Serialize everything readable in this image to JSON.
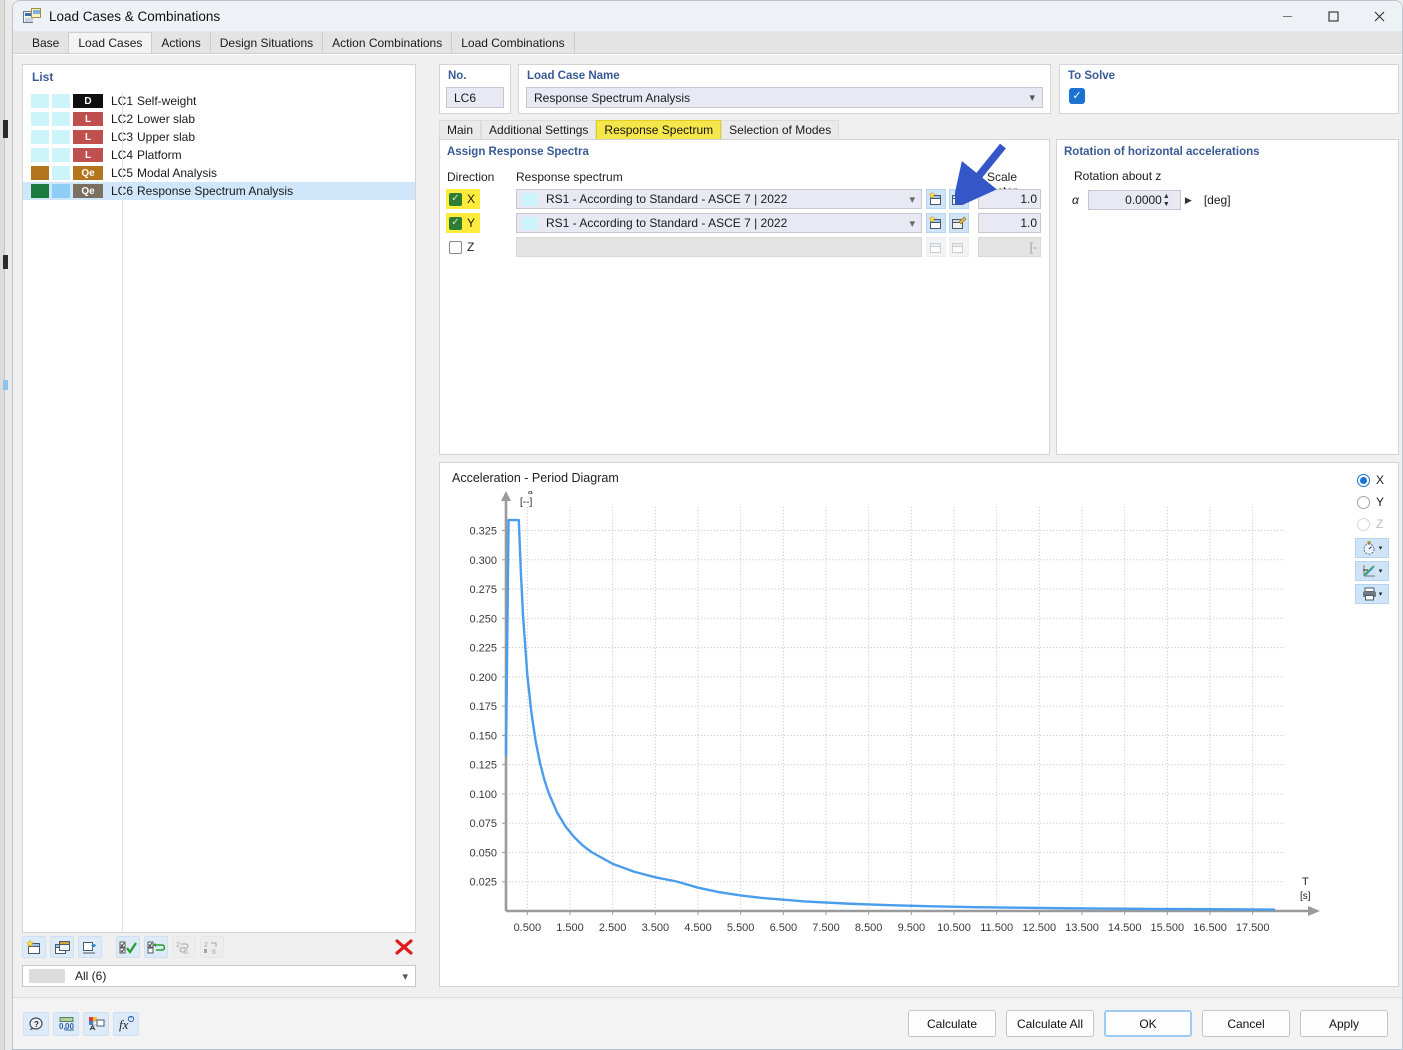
{
  "window": {
    "title": "Load Cases & Combinations",
    "icon": "load-cases-icon",
    "minimize": "—",
    "maximize": "☐",
    "close": "✕"
  },
  "main_tabs": [
    {
      "label": "Base",
      "active": false
    },
    {
      "label": "Load Cases",
      "active": true
    },
    {
      "label": "Actions",
      "active": false
    },
    {
      "label": "Design Situations",
      "active": false
    },
    {
      "label": "Action Combinations",
      "active": false
    },
    {
      "label": "Load Combinations",
      "active": false
    }
  ],
  "list_panel": {
    "header": "List",
    "rows": [
      {
        "no": "LC1",
        "name": "Self-weight",
        "category": "D",
        "cat_color": "#0f0f0f",
        "sw1": "#cdf3fb",
        "sw2": "#cdf3fb",
        "selected": false
      },
      {
        "no": "LC2",
        "name": "Lower slab",
        "category": "L",
        "cat_color": "#c0504d",
        "sw1": "#cdf3fb",
        "sw2": "#cdf3fb",
        "selected": false
      },
      {
        "no": "LC3",
        "name": "Upper slab",
        "category": "L",
        "cat_color": "#c0504d",
        "sw1": "#cdf3fb",
        "sw2": "#cdf3fb",
        "selected": false
      },
      {
        "no": "LC4",
        "name": "Platform",
        "category": "L",
        "cat_color": "#c0504d",
        "sw1": "#cdf3fb",
        "sw2": "#cdf3fb",
        "selected": false
      },
      {
        "no": "LC5",
        "name": "Modal Analysis",
        "category": "Qe",
        "cat_color": "#b3761f",
        "sw1": "#b3761f",
        "sw2": "#cdf3fb",
        "selected": false
      },
      {
        "no": "LC6",
        "name": "Response Spectrum Analysis",
        "category": "Qe",
        "cat_color": "#7a6f60",
        "sw1": "#1b7a3d",
        "sw2": "#8ecdf5",
        "selected": true
      }
    ],
    "toolbar": [
      {
        "name": "new-load-case-button",
        "enabled": true
      },
      {
        "name": "copy-load-case-button",
        "enabled": true
      },
      {
        "name": "import-load-case-button",
        "enabled": true
      },
      {
        "name": "select-all-button",
        "enabled": true
      },
      {
        "name": "invert-selection-button",
        "enabled": true
      },
      {
        "name": "renumber-button",
        "enabled": false
      },
      {
        "name": "sort-button",
        "enabled": false
      },
      {
        "name": "delete-load-case-button",
        "enabled": true
      }
    ],
    "filter": "All (6)"
  },
  "header": {
    "no_label": "No.",
    "no_value": "LC6",
    "name_label": "Load Case Name",
    "name_value": "Response Spectrum Analysis",
    "to_solve_label": "To Solve",
    "to_solve_checked": true,
    "check_glyph": "✓"
  },
  "inner_tabs": [
    {
      "label": "Main",
      "active": false
    },
    {
      "label": "Additional Settings",
      "active": false
    },
    {
      "label": "Response Spectrum",
      "active": true
    },
    {
      "label": "Selection of Modes",
      "active": false
    }
  ],
  "assign": {
    "title": "Assign Response Spectra",
    "col_direction": "Direction",
    "col_spectrum": "Response spectrum",
    "col_scale": "Scale factor",
    "rows": [
      {
        "direction": "X",
        "checked": true,
        "highlight": true,
        "spectrum": "RS1 - According to Standard - ASCE 7 | 2022",
        "scale": "1.0",
        "enabled": true
      },
      {
        "direction": "Y",
        "checked": true,
        "highlight": true,
        "spectrum": "RS1 - According to Standard - ASCE 7 | 2022",
        "scale": "1.0",
        "enabled": true
      },
      {
        "direction": "Z",
        "checked": false,
        "highlight": false,
        "spectrum": "",
        "scale": "[-",
        "enabled": false
      }
    ]
  },
  "rotation": {
    "title": "Rotation of horizontal accelerations",
    "sub_label": "Rotation about z",
    "alpha_symbol": "α",
    "alpha_value": "0.0000",
    "unit": "[deg]"
  },
  "chart_panel": {
    "title": "Acceleration - Period Diagram",
    "directions": [
      {
        "label": "X",
        "selected": true,
        "enabled": true
      },
      {
        "label": "Y",
        "selected": false,
        "enabled": true
      },
      {
        "label": "Z",
        "selected": false,
        "enabled": false
      }
    ],
    "tool_buttons": [
      {
        "name": "diagram-settings-button",
        "caret": "▾"
      },
      {
        "name": "diagram-style-button",
        "caret": "▾"
      },
      {
        "name": "print-diagram-button",
        "caret": "▾"
      }
    ]
  },
  "chart_data": {
    "type": "line",
    "title": "Acceleration - Period Diagram",
    "xlabel": "T",
    "xunit": "[s]",
    "ylabel": "Sa",
    "yunit": "[--]",
    "grid": true,
    "legend": false,
    "xlim": [
      0.0,
      18.0
    ],
    "ylim": [
      0.0,
      0.34
    ],
    "xticks": [
      0.5,
      1.5,
      2.5,
      3.5,
      4.5,
      5.5,
      6.5,
      7.5,
      8.5,
      9.5,
      10.5,
      11.5,
      12.5,
      13.5,
      14.5,
      15.5,
      16.5,
      17.5
    ],
    "yticks": [
      0.025,
      0.05,
      0.075,
      0.1,
      0.125,
      0.15,
      0.175,
      0.2,
      0.225,
      0.25,
      0.275,
      0.3,
      0.325
    ],
    "series": [
      {
        "name": "RS1 - According to Standard - ASCE 7 | 2022",
        "color": "#4a9ded",
        "x": [
          0.0,
          0.06,
          0.3,
          0.35,
          0.4,
          0.5,
          0.6,
          0.7,
          0.8,
          0.9,
          1.0,
          1.2,
          1.4,
          1.6,
          1.8,
          2.0,
          2.5,
          3.0,
          3.5,
          4.0,
          4.5,
          5.0,
          5.5,
          6.0,
          7.0,
          8.0,
          9.0,
          10.0,
          11.0,
          12.0,
          13.0,
          14.0,
          15.0,
          16.0,
          17.0,
          18.0
        ],
        "y": [
          0.1337,
          0.334,
          0.334,
          0.288,
          0.252,
          0.2016,
          0.168,
          0.144,
          0.126,
          0.112,
          0.1008,
          0.084,
          0.072,
          0.063,
          0.056,
          0.0504,
          0.0403,
          0.0336,
          0.0288,
          0.0252,
          0.0199,
          0.0161,
          0.0133,
          0.0112,
          0.0082,
          0.0063,
          0.005,
          0.004,
          0.0033,
          0.0028,
          0.0024,
          0.0021,
          0.0018,
          0.0016,
          0.0014,
          0.0012
        ]
      }
    ]
  },
  "footer": {
    "tools": [
      {
        "name": "help-tool-button"
      },
      {
        "name": "units-tool-button"
      },
      {
        "name": "display-properties-button"
      },
      {
        "name": "formula-tool-button"
      }
    ],
    "buttons": [
      {
        "label": "Calculate",
        "primary": false
      },
      {
        "label": "Calculate All",
        "primary": false
      },
      {
        "label": "OK",
        "primary": true
      },
      {
        "label": "Cancel",
        "primary": false
      },
      {
        "label": "Apply",
        "primary": false
      }
    ]
  },
  "annotation": {
    "arrow_color": "#3457c8",
    "name": "pointer-arrow"
  }
}
